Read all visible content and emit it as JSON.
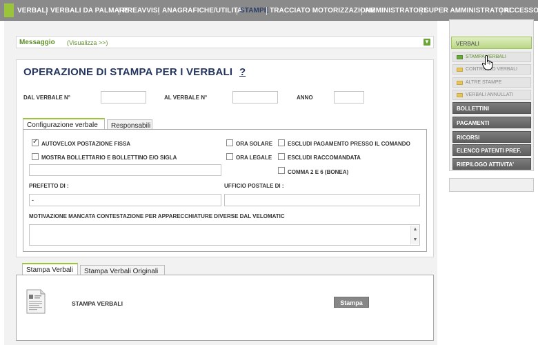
{
  "nav": {
    "items": [
      "VERBALI",
      "VERBALI DA PALMARE",
      "PREAVVISI",
      "ANAGRAFICHE/UTILITA'",
      "STAMPE",
      "TRACCIATO MOTORIZZAZIONE",
      "AMMINISTRATORI",
      "SUPER AMMINISTRATORI",
      "ACCESSO"
    ],
    "active": "STAMPE"
  },
  "message": {
    "title": "Messaggio",
    "link": "(Visualizza >>)"
  },
  "operation": {
    "heading": "OPERAZIONE DI STAMPA PER I VERBALI",
    "help": "?",
    "dal_label": "DAL VERBALE N°",
    "al_label": "AL VERBALE N°",
    "anno_label": "ANNO",
    "dal_value": "",
    "al_value": "",
    "anno_value": ""
  },
  "config_tabs": [
    "Configurazione verbale",
    "Responsabili"
  ],
  "options": {
    "autovelox": {
      "label": "AUTOVELOX POSTAZIONE FISSA",
      "checked": true
    },
    "mostra_bollettario": {
      "label": "MOSTRA BOLLETTARIO E BOLLETTINO E/O SIGLA",
      "checked": false
    },
    "ora_solare": {
      "label": "ORA SOLARE",
      "checked": false
    },
    "ora_legale": {
      "label": "ORA LEGALE",
      "checked": false
    },
    "escludi_pagamento": {
      "label": "ESCLUDI PAGAMENTO PRESSO IL COMANDO",
      "checked": false
    },
    "escludi_raccomandata": {
      "label": "ESCLUDI RACCOMANDATA",
      "checked": false
    },
    "comma": {
      "label": "COMMA 2 E 6 (BONEA)",
      "checked": false
    }
  },
  "fields": {
    "sigla_value": "",
    "prefetto_label": "PREFETTO DI :",
    "prefetto_value": "-",
    "ufficio_label": "UFFICIO POSTALE DI :",
    "ufficio_value": "",
    "motivazione_label": "MOTIVAZIONE MANCATA CONTESTAZIONE PER APPARECCHIATURE DIVERSE DAL VELOMATIC",
    "motivazione_value": ""
  },
  "print_tabs": [
    "Stampa Verbali",
    "Stampa Verbali Originali"
  ],
  "print": {
    "label": "STAMPA VERBALI",
    "button": "Stampa"
  },
  "sidebar": {
    "header": "VERBALI",
    "subitems": [
      "STAMPA VERBALI",
      "CONTROLLO VERBALI",
      "ALTRE STAMPE",
      "VERBALI ANNULLATI"
    ],
    "items": [
      "BOLLETTINI",
      "PAGAMENTI",
      "RICORSI",
      "ELENCO PATENTI PREF.",
      "RIEPILOGO ATTIVITA'"
    ]
  },
  "colors": {
    "accent": "#9ac43a",
    "nav": "#8a8a8a",
    "heading": "#243660",
    "sidebar_item": "#6f6f6f"
  }
}
